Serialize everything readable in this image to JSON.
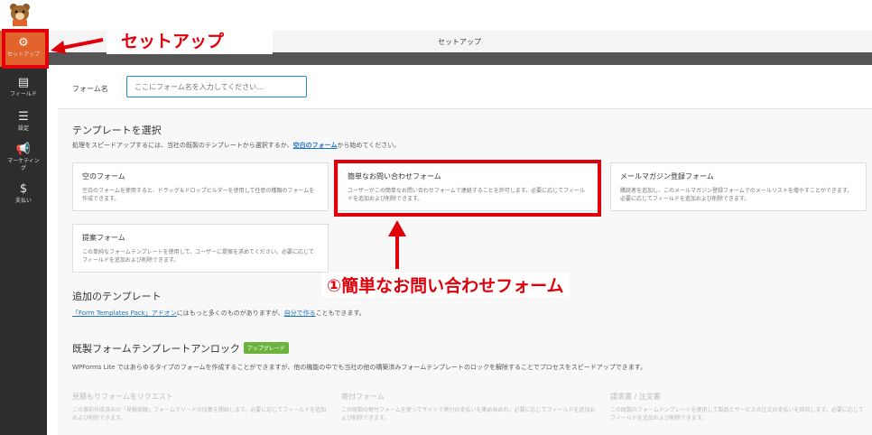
{
  "sidebar": {
    "items": [
      {
        "label": "セットアップ",
        "icon": "gear-icon"
      },
      {
        "label": "フィールド",
        "icon": "fields-icon"
      },
      {
        "label": "設定",
        "icon": "sliders-icon"
      },
      {
        "label": "マーケティング",
        "icon": "megaphone-icon"
      },
      {
        "label": "支払い",
        "icon": "dollar-icon"
      }
    ]
  },
  "topbar": {
    "title": "セットアップ"
  },
  "form_name": {
    "label": "フォーム名",
    "placeholder": "ここにフォーム名を入力してください..."
  },
  "templates": {
    "heading": "テンプレートを選択",
    "subtitle_before": "処理をスピードアップするには、当社の既製のテンプレートから選択するか、",
    "subtitle_link": "空白のフォーム",
    "subtitle_after": "から始めてください。",
    "cards": [
      {
        "title": "空のフォーム",
        "desc": "空白のフォームを使用すると、ドラッグ＆ドロップビルダーを使用して任意の種類のフォームを作成できます。"
      },
      {
        "title": "簡単なお問い合わせフォーム",
        "desc": "ユーザーがこの簡単なお問い合わせフォームで連絡することを許可します。必要に応じてフィールドを追加および削除できます。"
      },
      {
        "title": "メールマガジン登録フォーム",
        "desc": "購読者を追加し、このメールマガジン登録フォームでのメールリストを増やすことができます。必要に応じてフィールドを追加および削除できます。"
      },
      {
        "title": "提案フォーム",
        "desc": "この単純なフォームテンプレートを使用して、ユーザーに提案を求めてください。必要に応じてフィールドを追加および削除できます。"
      }
    ]
  },
  "additional": {
    "heading": "追加のテンプレート",
    "link1": "「Form Templates Pack」アドオン",
    "text1": "にはもっと多くのものがありますが、",
    "link2": "自分で作る",
    "text2": "こともできます。"
  },
  "unlock": {
    "heading": "既製フォームテンプレートアンロック",
    "badge": "アップグレード",
    "subtitle": "WPForms Lite ではあらゆるタイプのフォームを作成することができますが、他の機能の中でも当社の他の構築済みフォームテンプレートのロックを解除することでプロセスをスピードアップできます。",
    "cards": [
      {
        "title": "見積もりフォームをリクエスト",
        "desc": "この事前作成済みの「見積依頼」フォームでリードの収集を開始します。必要に応じてフィールドを追加および削除できます。"
      },
      {
        "title": "寄付フォーム",
        "desc": "この既製の寄付フォームを使ってサイトで寄付の支払いを集め始めれ。必要に応じてフィールドを追加および削除できます。"
      },
      {
        "title": "請求書 / 注文書",
        "desc": "この既製のフォームテンプレートを使用して製品とサービスの注文の支払いを回収します。必要に応じてフィールドを追加および削除できます。"
      }
    ]
  },
  "annotations": {
    "setup_callout": "セットアップ",
    "contact_callout": "①簡単なお問い合わせフォーム"
  },
  "colors": {
    "accent": "#e2642c",
    "annotation_red": "#e0000a",
    "link": "#1d74c4",
    "badge_green": "#6bb33d"
  }
}
